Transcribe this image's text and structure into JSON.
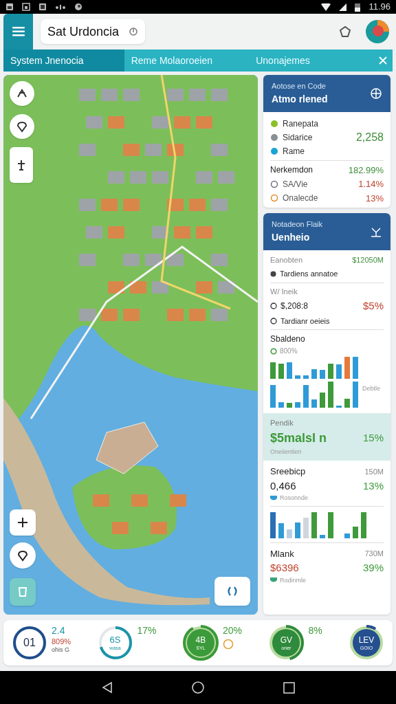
{
  "status_bar": {
    "time": "11.96"
  },
  "header": {
    "search": {
      "value": "Sat Urdoncia"
    }
  },
  "tabs": [
    {
      "label": "System Jnenocia",
      "selected": true
    },
    {
      "label": "Reme Molaoroeien",
      "selected": false
    },
    {
      "label": "Unonajemes",
      "selected": false
    }
  ],
  "summary_card": {
    "subtitle": "Aotose en Code",
    "title": "Atmo rlened",
    "rows": [
      {
        "label": "Ranepata",
        "color": "#8bbf2a"
      },
      {
        "label": "Sidarice",
        "value": "2,258",
        "color": "#8a8f96"
      },
      {
        "label": "Rame",
        "color": "#1ba3d6"
      }
    ],
    "metrics": [
      {
        "kind": "gain",
        "label": "Nerkemdon",
        "value": "182.99%"
      },
      {
        "kind": "loss",
        "label": "SA/Vie",
        "value": "1.14%",
        "color": "#6b7280"
      },
      {
        "kind": "loss",
        "label": "Onalecde",
        "value": "13%",
        "color": "#e08a2c"
      }
    ]
  },
  "detail_card": {
    "subtitle": "Notadeon Flaik",
    "title": "Uenheio",
    "top": {
      "label": "Eanobten",
      "value": "$12050M",
      "note": "Tardiens annatoe"
    },
    "mid": {
      "label": "W/ Ineik",
      "amount": "$,208:8",
      "change": "$5%",
      "note": "Tardianr oeieis"
    },
    "chart": {
      "title": "Sbaldeno",
      "legend": "800%",
      "side_label": "Debtle"
    },
    "highlight": {
      "label": "Pendik",
      "value": "$5malsI n",
      "change": "15%",
      "note": "Oneiientien"
    },
    "second": {
      "label": "Sreebicp",
      "side": "150M",
      "value": "0,466",
      "change": "13%",
      "note": "Rosonnde"
    },
    "third": {
      "label": "Mlank",
      "side": "730M",
      "value": "$6396",
      "change": "39%",
      "note": "Rodinmle"
    }
  },
  "bottom_stats": [
    {
      "kind": "ring",
      "center": "01",
      "lines": [
        "2.4",
        "809%",
        "ohis G"
      ],
      "level": 1,
      "color": "#1f4e8c"
    },
    {
      "kind": "ring",
      "center": "6S",
      "sub": "wasa",
      "lines": [
        "17%"
      ],
      "level": 0.7,
      "color": "#1a94a8"
    },
    {
      "kind": "disc",
      "center": "4B",
      "sub": "SYL",
      "lines": [
        "20%"
      ],
      "level": 1,
      "color": "#3b9a3a"
    },
    {
      "kind": "disc",
      "center": "GV",
      "sub": "oner",
      "lines": [
        "8%"
      ],
      "level": 0.5,
      "color": "#2e8a3c"
    },
    {
      "kind": "disc",
      "center": "LEV",
      "sub": "GOIO",
      "level": 0.1,
      "color": "#254f8e"
    }
  ]
}
